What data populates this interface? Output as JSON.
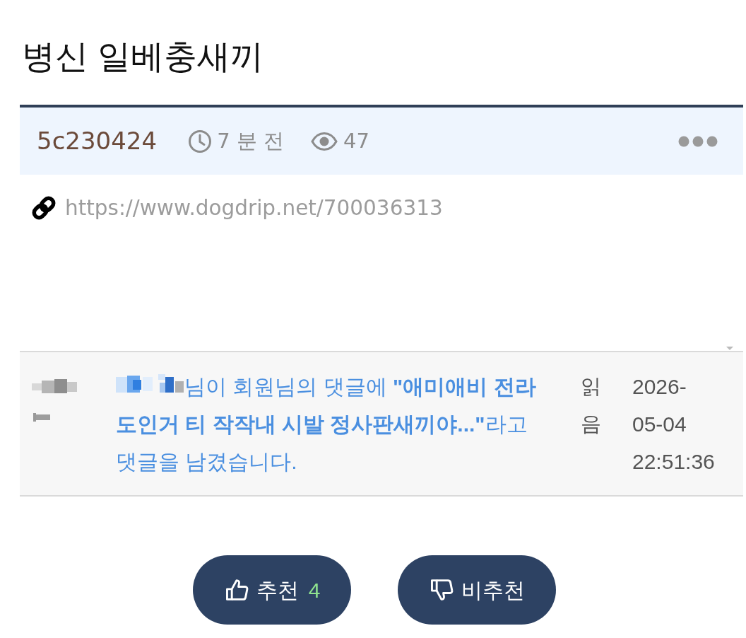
{
  "post": {
    "title": "병신 일베충새끼",
    "author": "5c230424",
    "time": "7 분 전",
    "views": "47",
    "link": "https://www.dogdrip.net/700036313"
  },
  "notification": {
    "message": "님이 회원님의 댓글에 **\"애미애비 전라도인거 티 작작내 시발 정사판새끼야...\"**라고 댓글을 남겼습니다.",
    "status": "읽음",
    "date": "2026-05-04",
    "time": "22:51:36"
  },
  "votes": [
    {
      "kind": "up",
      "label": "추천",
      "count": "4"
    },
    {
      "kind": "down",
      "label": "비추천"
    }
  ]
}
